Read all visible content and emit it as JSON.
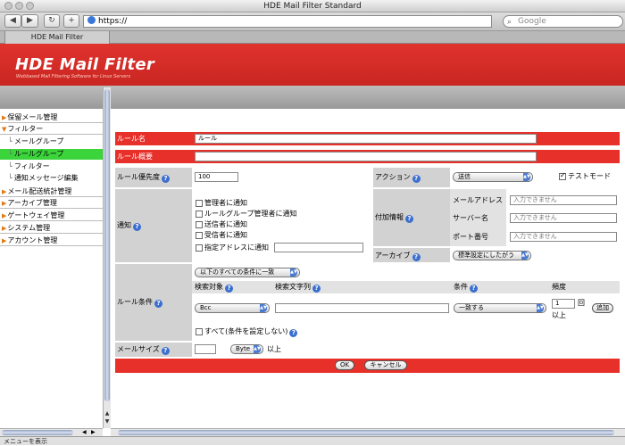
{
  "window": {
    "title": "HDE Mail Filter Standard"
  },
  "browser": {
    "back_label": "◀",
    "forward_label": "▶",
    "reload_label": "↻",
    "add_label": "+",
    "url": "https://",
    "search_placeholder": "Google",
    "tab_label": "HDE Mail Filter"
  },
  "banner": {
    "logo": "HDE Mail Filter",
    "tagline": "Webbased Mail Filtering Software for Linux Servers"
  },
  "sidebar": {
    "items": [
      {
        "label": "保留メール管理"
      },
      {
        "label": "フィルター"
      },
      {
        "label": "メールグループ"
      },
      {
        "label": "ルールグループ"
      },
      {
        "label": "フィルター"
      },
      {
        "label": "通知メッセージ編集"
      },
      {
        "label": "メール配送統計管理"
      },
      {
        "label": "アーカイブ管理"
      },
      {
        "label": "ゲートウェイ管理"
      },
      {
        "label": "システム管理"
      },
      {
        "label": "アカウント管理"
      }
    ]
  },
  "form": {
    "rule_name_label": "ルール名",
    "rule_name_value": "ルール",
    "rule_desc_label": "ルール概要",
    "rule_desc_value": "",
    "priority_label": "ルール優先度",
    "priority_value": "100",
    "action_label": "アクション",
    "action_value": "送信",
    "test_mode_label": "テストモード",
    "notify_label": "通知",
    "notify_options": [
      "管理者に通知",
      "ルールグループ管理者に通知",
      "送信者に通知",
      "受信者に通知",
      "指定アドレスに通知"
    ],
    "extra_info_label": "付加情報",
    "mail_address_label": "メールアドレス",
    "server_name_label": "サーバー名",
    "port_label": "ポート番号",
    "unavailable_text": "入力できません",
    "archive_label": "アーカイブ",
    "archive_value": "標準設定にしたがう",
    "condition_label": "ルール条件",
    "condition_mode": "以下のすべての条件に一致",
    "col_target": "検索対象",
    "col_string": "検索文字列",
    "col_condition": "条件",
    "col_frequency": "頻度",
    "target_value": "Bcc",
    "match_value": "一致する",
    "frequency_value": "1",
    "frequency_unit": "回",
    "frequency_suffix": "以上",
    "add_button": "追加",
    "all_option": "すべて(条件を設定しない)",
    "mail_size_label": "メールサイズ",
    "size_unit": "Byte",
    "size_suffix": "以上",
    "ok_button": "OK",
    "cancel_button": "キャンセル"
  },
  "status": {
    "text": "メニューを表示"
  }
}
